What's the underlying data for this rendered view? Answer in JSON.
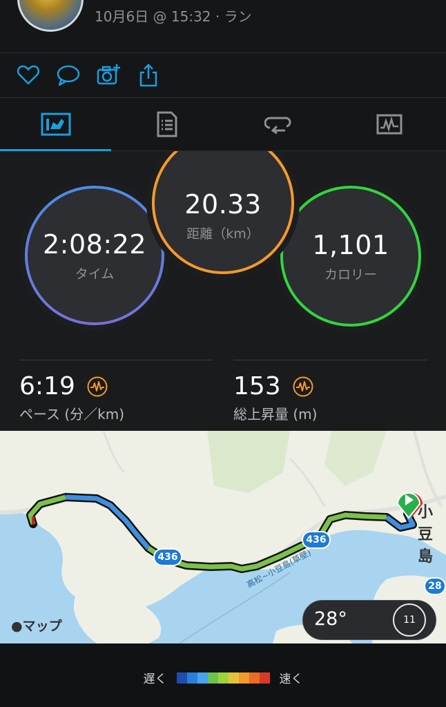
{
  "header": {
    "date_text": "10月6日 @ 15:32 · ラン"
  },
  "actions": {
    "like": "heart-icon",
    "comment": "comment-icon",
    "add_photo": "add-photo-icon",
    "share": "share-icon",
    "accent": "#1a9fe0"
  },
  "tabs": [
    {
      "icon": "overview-icon"
    },
    {
      "icon": "details-icon"
    },
    {
      "icon": "laps-icon"
    },
    {
      "icon": "graph-icon"
    }
  ],
  "rings": {
    "time": {
      "value": "2:08:22",
      "label": "タイム"
    },
    "distance": {
      "value": "20.33",
      "label": "距離（km）"
    },
    "calories": {
      "value": "1,101",
      "label": "カロリー"
    }
  },
  "metrics": {
    "pace": {
      "value": "6:19",
      "label": "ペース (分／km)"
    },
    "ascent": {
      "value": "153",
      "label": "総上昇量 (m)"
    }
  },
  "map": {
    "attribution": "マップ",
    "road_label_1": "436",
    "road_label_2": "436",
    "road_label_3": "28",
    "ferry_label": "高松~小豆島(草壁)",
    "town_label": "小豆島",
    "weather_temp": "28°",
    "wind_speed": "11"
  },
  "legend": {
    "slow": "遅く",
    "fast": "速く",
    "colors": [
      "#1e4fb0",
      "#2a7fd8",
      "#4aa3ee",
      "#6cc24a",
      "#9dd33a",
      "#e6c23a",
      "#f39a2c",
      "#ee6b26",
      "#d83a2a"
    ]
  }
}
